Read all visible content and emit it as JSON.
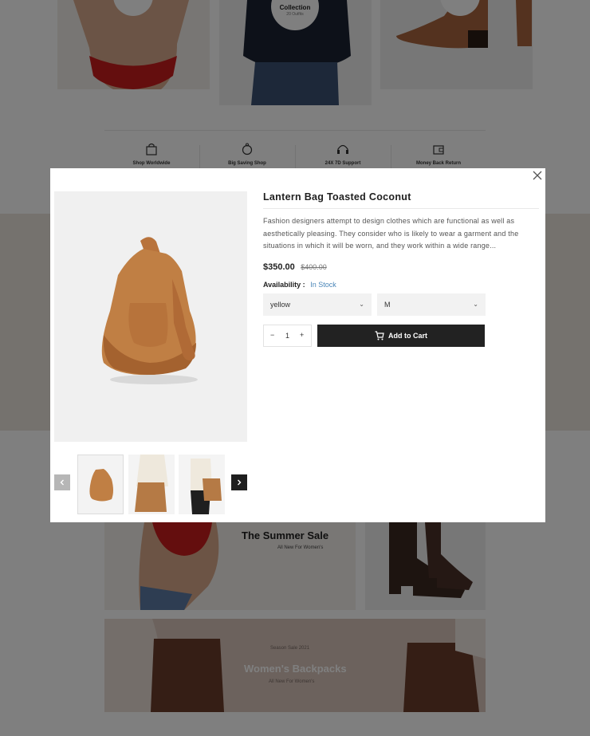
{
  "background": {
    "collection_badge": {
      "title": "Collection",
      "sub": "20 Outfits"
    },
    "features": [
      {
        "icon": "shopping-bag-icon",
        "label": "Shop Worldwide"
      },
      {
        "icon": "piggy-bank-icon",
        "label": "Big Saving Shop"
      },
      {
        "icon": "headset-icon",
        "label": "24X 7D Support"
      },
      {
        "icon": "wallet-icon",
        "label": "Money Back Return"
      }
    ],
    "summer_sale": {
      "title": "The Summer Sale",
      "sub": "All New For Women's"
    },
    "backpacks": {
      "kicker": "Season Sale 2021",
      "title": "Women's Backpacks",
      "sub": "All New For Women's"
    }
  },
  "modal": {
    "title": "Lantern Bag Toasted Coconut",
    "description": "Fashion designers attempt to design clothes which are functional as well as aesthetically pleasing. They consider who is likely to wear a garment and the situations in which it will be worn, and they work within a wide range...",
    "price": "$350.00",
    "old_price": "$400.00",
    "availability_label": "Availability :",
    "availability_value": "In Stock",
    "color_select": "yellow",
    "size_select": "M",
    "quantity": "1",
    "minus": "−",
    "plus": "+",
    "add_to_cart": "Add to Cart",
    "colors": {
      "accent": "#4a86b8",
      "button": "#222222"
    }
  }
}
